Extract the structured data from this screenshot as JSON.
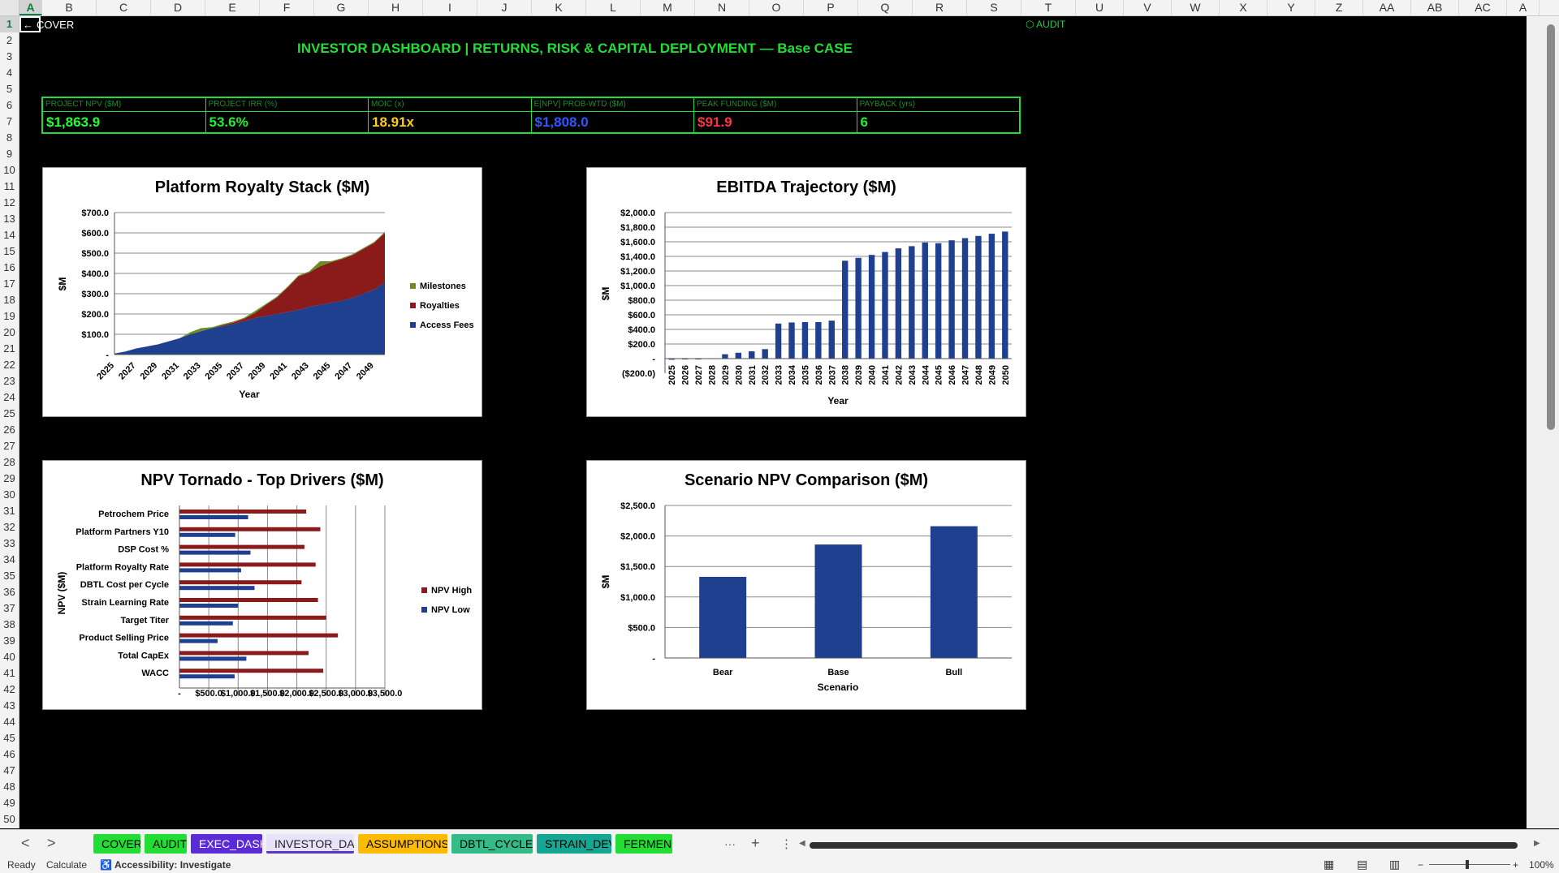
{
  "columns": [
    "A",
    "B",
    "C",
    "D",
    "E",
    "F",
    "G",
    "H",
    "I",
    "J",
    "K",
    "L",
    "M",
    "N",
    "O",
    "P",
    "Q",
    "R",
    "S",
    "T",
    "U",
    "V",
    "W",
    "X",
    "Y",
    "Z",
    "AA",
    "AB",
    "AC",
    "A"
  ],
  "rows": [
    "1",
    "2",
    "3",
    "4",
    "5",
    "6",
    "7",
    "8",
    "9",
    "10",
    "11",
    "12",
    "13",
    "14",
    "15",
    "16",
    "17",
    "18",
    "19",
    "20",
    "21",
    "22",
    "23",
    "24",
    "25",
    "26",
    "27",
    "28",
    "29",
    "30",
    "31",
    "32",
    "33",
    "34",
    "35",
    "36",
    "37",
    "38",
    "39",
    "40",
    "41",
    "42",
    "43",
    "44",
    "45",
    "46",
    "47",
    "48",
    "49",
    "50"
  ],
  "cover_link": {
    "arrow": "←",
    "label": "COVER"
  },
  "audit_link": {
    "label": "⬡ AUDIT"
  },
  "title": "INVESTOR DASHBOARD  |  RETURNS, RISK & CAPITAL DEPLOYMENT  —  Base CASE",
  "kpis": [
    {
      "label": "PROJECT NPV ($M)",
      "value": "$1,863.9",
      "color": "#22ff33"
    },
    {
      "label": "PROJECT IRR (%)",
      "value": "53.6%",
      "color": "#22ee33"
    },
    {
      "label": "MOIC (x)",
      "value": "18.91x",
      "color": "#ffcc22"
    },
    {
      "label": "E[NPV] PROB-WTD ($M)",
      "value": "$1,808.0",
      "color": "#3355ff"
    },
    {
      "label": "PEAK FUNDING ($M)",
      "value": "$91.9",
      "color": "#ff3344"
    },
    {
      "label": "PAYBACK (yrs)",
      "value": "6",
      "color": "#22ee33"
    }
  ],
  "chart_data": [
    {
      "id": "royalty",
      "type": "area",
      "title": "Platform Royalty Stack ($M)",
      "xlabel": "Year",
      "ylabel": "$M",
      "x": [
        2025,
        2026,
        2027,
        2028,
        2029,
        2030,
        2031,
        2032,
        2033,
        2034,
        2035,
        2036,
        2037,
        2038,
        2039,
        2040,
        2041,
        2042,
        2043,
        2044,
        2045,
        2046,
        2047,
        2048,
        2049,
        2050
      ],
      "x_tick_labels": [
        "2025",
        "2027",
        "2029",
        "2031",
        "2033",
        "2035",
        "2037",
        "2039",
        "2041",
        "2043",
        "2045",
        "2047",
        "2049"
      ],
      "y_tick_labels": [
        "-",
        "$100.0",
        "$200.0",
        "$300.0",
        "$400.0",
        "$500.0",
        "$600.0",
        "$700.0"
      ],
      "ylim": [
        0,
        700
      ],
      "series": [
        {
          "name": "Access Fees",
          "color": "#1f3f8f",
          "values": [
            5,
            15,
            30,
            40,
            50,
            65,
            80,
            100,
            115,
            130,
            140,
            150,
            165,
            180,
            190,
            200,
            210,
            220,
            235,
            245,
            255,
            265,
            280,
            300,
            320,
            355
          ]
        },
        {
          "name": "Royalties",
          "color": "#8b1a1a",
          "values": [
            0,
            0,
            0,
            0,
            0,
            0,
            0,
            0,
            0,
            0,
            5,
            8,
            12,
            25,
            55,
            80,
            120,
            165,
            170,
            190,
            200,
            205,
            210,
            220,
            230,
            245
          ]
        },
        {
          "name": "Milestones",
          "color": "#6b8e23",
          "values": [
            0,
            0,
            0,
            0,
            0,
            0,
            0,
            10,
            15,
            5,
            5,
            5,
            5,
            10,
            5,
            5,
            5,
            5,
            5,
            25,
            5,
            5,
            5,
            5,
            5,
            5
          ]
        }
      ],
      "legend": "right"
    },
    {
      "id": "ebitda",
      "type": "bar",
      "title": "EBITDA Trajectory ($M)",
      "xlabel": "Year",
      "ylabel": "$M",
      "categories": [
        "2025",
        "2026",
        "2027",
        "2028",
        "2029",
        "2030",
        "2031",
        "2032",
        "2033",
        "2034",
        "2035",
        "2036",
        "2037",
        "2038",
        "2039",
        "2040",
        "2041",
        "2042",
        "2043",
        "2044",
        "2045",
        "2046",
        "2047",
        "2048",
        "2049",
        "2050"
      ],
      "values": [
        -15,
        -10,
        -8,
        5,
        60,
        80,
        100,
        130,
        480,
        495,
        500,
        500,
        520,
        1340,
        1380,
        1420,
        1460,
        1510,
        1540,
        1590,
        1580,
        1620,
        1650,
        1680,
        1710,
        1740
      ],
      "y_tick_labels": [
        "($200.0)",
        "-",
        "$200.0",
        "$400.0",
        "$600.0",
        "$800.0",
        "$1,000.0",
        "$1,200.0",
        "$1,400.0",
        "$1,600.0",
        "$1,800.0",
        "$2,000.0"
      ],
      "ylim": [
        -200,
        2000
      ],
      "color": "#1f3f8f"
    },
    {
      "id": "tornado",
      "type": "bar",
      "orientation": "horizontal",
      "title": "NPV Tornado - Top Drivers ($M)",
      "ylabel": "NPV ($M)",
      "categories": [
        "Petrochem Price",
        "Platform Partners Y10",
        "DSP Cost %",
        "Platform Royalty Rate",
        "DBTL Cost per Cycle",
        "Strain Learning Rate",
        "Target Titer",
        "Product Selling Price",
        "Total CapEx",
        "WACC"
      ],
      "series": [
        {
          "name": "NPV High",
          "color": "#8b1a1a",
          "values": [
            2160,
            2400,
            2130,
            2320,
            2080,
            2360,
            2500,
            2700,
            2200,
            2450
          ]
        },
        {
          "name": "NPV Low",
          "color": "#1f3f8f",
          "values": [
            1170,
            950,
            1210,
            1050,
            1280,
            1000,
            910,
            650,
            1140,
            940
          ]
        }
      ],
      "x_tick_labels": [
        "-",
        "$500.0",
        "$1,000.0",
        "$1,500.0",
        "$2,000.0",
        "$2,500.0",
        "$3,000.0",
        "$3,500.0"
      ],
      "xlim": [
        0,
        3500
      ],
      "legend": "right"
    },
    {
      "id": "scenario",
      "type": "bar",
      "title": "Scenario NPV Comparison ($M)",
      "xlabel": "Scenario",
      "ylabel": "$M",
      "categories": [
        "Bear",
        "Base",
        "Bull"
      ],
      "values": [
        1330,
        1860,
        2160
      ],
      "y_tick_labels": [
        "-",
        "$500.0",
        "$1,000.0",
        "$1,500.0",
        "$2,000.0",
        "$2,500.0"
      ],
      "ylim": [
        0,
        2500
      ],
      "color": "#1f3f8f"
    }
  ],
  "tabs": [
    {
      "label": "COVER",
      "bg": "#22dd33",
      "fg": "#000"
    },
    {
      "label": "AUDIT",
      "bg": "#22dd33",
      "fg": "#000"
    },
    {
      "label": "EXEC_DASH",
      "bg": "#5b2bd8",
      "fg": "#fff"
    },
    {
      "label": "INVESTOR_DASH",
      "bg": "#e8e2fb",
      "fg": "#222",
      "active": true
    },
    {
      "label": "ASSUMPTIONS",
      "bg": "#ffbb00",
      "fg": "#000"
    },
    {
      "label": "DBTL_CYCLES",
      "bg": "#33bb88",
      "fg": "#000"
    },
    {
      "label": "STRAIN_DEV",
      "bg": "#14a894",
      "fg": "#000"
    },
    {
      "label": "FERMEN",
      "bg": "#22dd33",
      "fg": "#000"
    }
  ],
  "tab_nav": {
    "prev": "<",
    "next": ">",
    "more": "···",
    "add": "+",
    "options": "⋮"
  },
  "status": {
    "ready": "Ready",
    "calculate": "Calculate",
    "accessibility": "Accessibility: Investigate",
    "zoom": "100%"
  }
}
